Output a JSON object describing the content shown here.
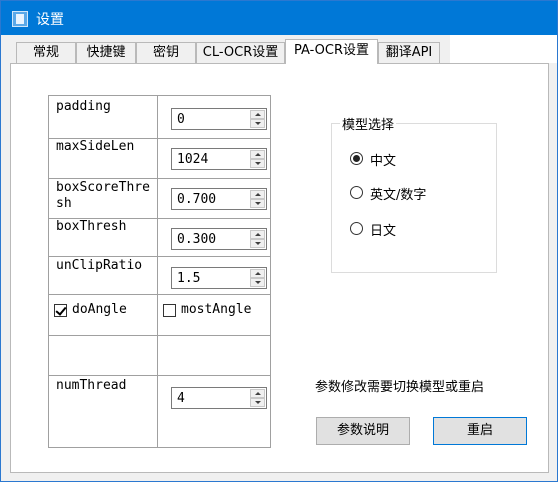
{
  "window": {
    "title": "设置"
  },
  "tabs": [
    {
      "label": "常规"
    },
    {
      "label": "快捷键"
    },
    {
      "label": "密钥"
    },
    {
      "label": "CL-OCR设置"
    },
    {
      "label": "PA-OCR设置"
    },
    {
      "label": "翻译API"
    }
  ],
  "params": [
    {
      "label": "padding",
      "value": "0"
    },
    {
      "label": "maxSideLen",
      "value": "1024"
    },
    {
      "label": "boxScoreThresh",
      "value": "0.700"
    },
    {
      "label": "boxThresh",
      "value": "0.300"
    },
    {
      "label": "unClipRatio",
      "value": "1.5"
    },
    {
      "label": "numThread",
      "value": "4"
    }
  ],
  "checkboxes": [
    {
      "label": "doAngle",
      "checked": true
    },
    {
      "label": "mostAngle",
      "checked": false
    }
  ],
  "model_group": {
    "title": "模型选择",
    "options": [
      {
        "label": "中文",
        "selected": true
      },
      {
        "label": "英文/数字",
        "selected": false
      },
      {
        "label": "日文",
        "selected": false
      }
    ]
  },
  "note": "参数修改需要切换模型或重启",
  "buttons": {
    "help": "参数说明",
    "restart": "重启"
  }
}
